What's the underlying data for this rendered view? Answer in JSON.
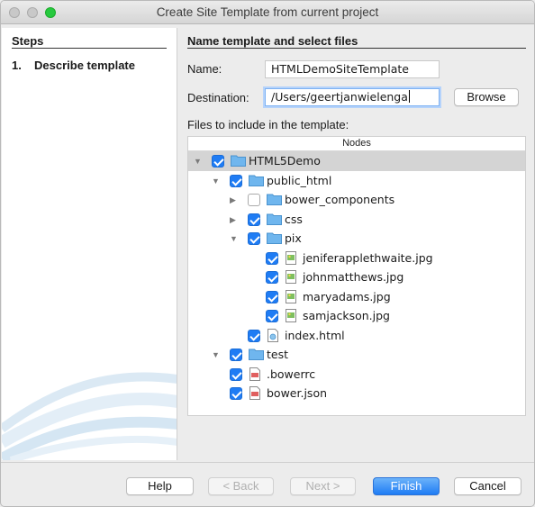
{
  "window": {
    "title": "Create Site Template from current project"
  },
  "steps": {
    "heading": "Steps",
    "items": [
      {
        "number": "1.",
        "label": "Describe template"
      }
    ]
  },
  "form": {
    "heading": "Name template and select files",
    "name_label": "Name:",
    "name_value": "HTMLDemoSiteTemplate",
    "destination_label": "Destination:",
    "destination_value": "/Users/geertjanwielenga",
    "browse_label": "Browse",
    "files_label": "Files to include in the template:"
  },
  "tree": {
    "header": "Nodes",
    "nodes": [
      {
        "label": "HTML5Demo",
        "type": "folder",
        "checked": true,
        "expanded": true,
        "selected": true
      },
      {
        "label": "public_html",
        "type": "folder",
        "checked": true,
        "expanded": true
      },
      {
        "label": "bower_components",
        "type": "folder",
        "checked": false,
        "expanded": false
      },
      {
        "label": "css",
        "type": "folder",
        "checked": true,
        "expanded": false
      },
      {
        "label": "pix",
        "type": "folder",
        "checked": true,
        "expanded": true
      },
      {
        "label": "jeniferapplethwaite.jpg",
        "type": "image-file",
        "checked": true
      },
      {
        "label": "johnmatthews.jpg",
        "type": "image-file",
        "checked": true
      },
      {
        "label": "maryadams.jpg",
        "type": "image-file",
        "checked": true
      },
      {
        "label": "samjackson.jpg",
        "type": "image-file",
        "checked": true
      },
      {
        "label": "index.html",
        "type": "html-file",
        "checked": true
      },
      {
        "label": "test",
        "type": "folder",
        "checked": true,
        "expanded": true
      },
      {
        "label": ".bowerrc",
        "type": "config-file",
        "checked": true
      },
      {
        "label": "bower.json",
        "type": "config-file",
        "checked": true
      }
    ]
  },
  "buttons": {
    "help": "Help",
    "back": "< Back",
    "next": "Next >",
    "finish": "Finish",
    "cancel": "Cancel"
  },
  "colors": {
    "accent": "#1f7cf4",
    "folder": "#6fb6ee",
    "selection": "#d4d4d4"
  }
}
